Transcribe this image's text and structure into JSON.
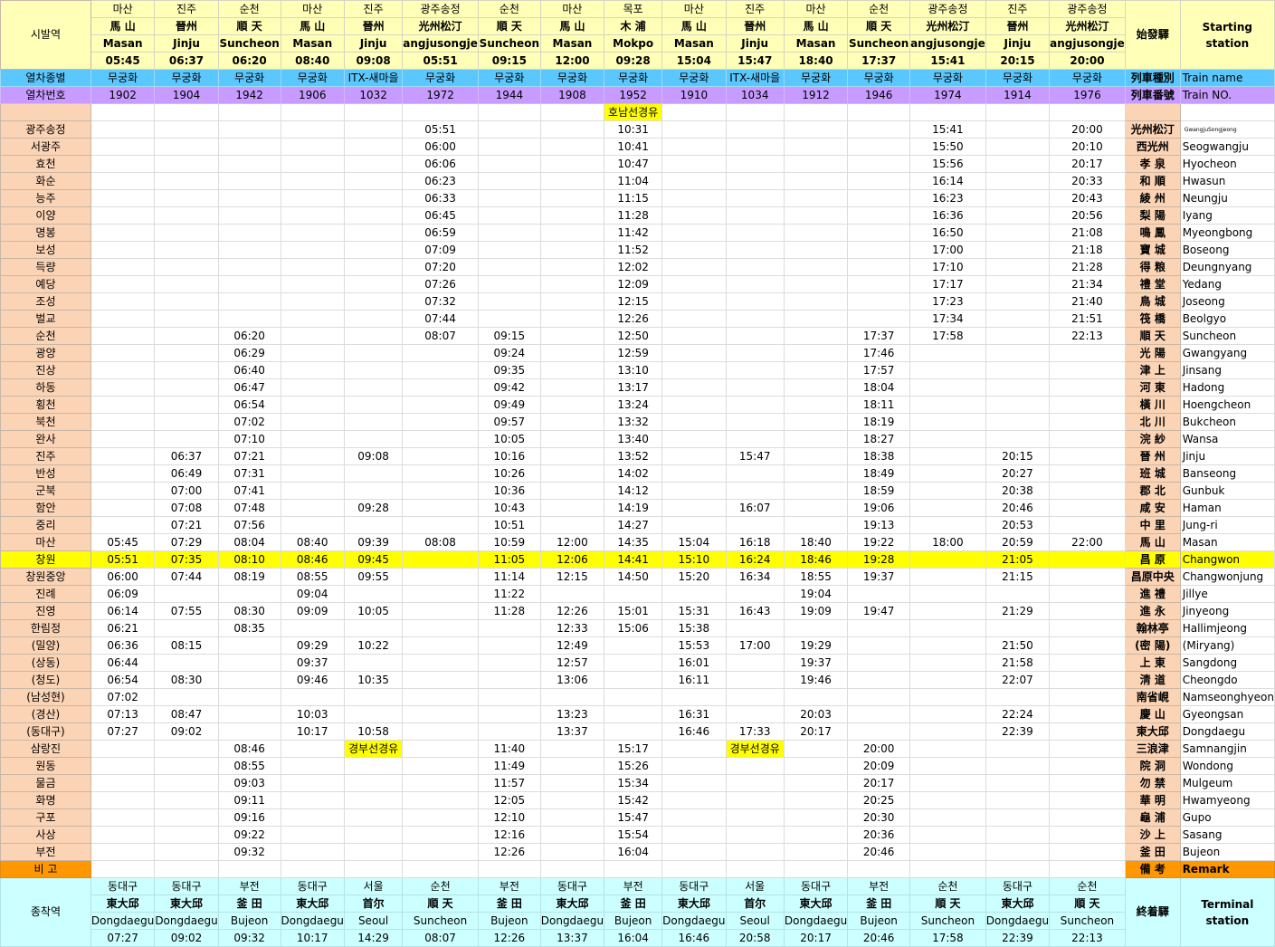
{
  "header": {
    "start_label": "시발역",
    "start_label_hanja": "始發驛",
    "start_label_en": "Starting station",
    "kind_label": "열차종별",
    "kind_label_hanja": "列車種別",
    "kind_label_en": "Train name",
    "num_label": "열차번호",
    "num_label_hanja": "列車番號",
    "num_label_en": "Train NO.",
    "remark_label": "비 고",
    "remark_label_hanja": "備 考",
    "remark_label_en": "Remark",
    "term_label": "종착역",
    "term_label_hanja": "終着驛",
    "term_label_en": "Terminal station"
  },
  "trains": [
    {
      "start_ko": "마산",
      "start_hj": "馬 山",
      "start_en": "Masan",
      "start_time": "05:45",
      "kind": "무궁화",
      "no": "1902",
      "term_ko": "동대구",
      "term_hj": "東大邱",
      "term_en": "Dongdaegu",
      "term_time": "07:27"
    },
    {
      "start_ko": "진주",
      "start_hj": "晉州",
      "start_en": "Jinju",
      "start_time": "06:37",
      "kind": "무궁화",
      "no": "1904",
      "term_ko": "동대구",
      "term_hj": "東大邱",
      "term_en": "Dongdaegu",
      "term_time": "09:02"
    },
    {
      "start_ko": "순천",
      "start_hj": "順 天",
      "start_en": "Suncheon",
      "start_time": "06:20",
      "kind": "무궁화",
      "no": "1942",
      "term_ko": "부전",
      "term_hj": "釜 田",
      "term_en": "Bujeon",
      "term_time": "09:32"
    },
    {
      "start_ko": "마산",
      "start_hj": "馬 山",
      "start_en": "Masan",
      "start_time": "08:40",
      "kind": "무궁화",
      "no": "1906",
      "term_ko": "동대구",
      "term_hj": "東大邱",
      "term_en": "Dongdaegu",
      "term_time": "10:17"
    },
    {
      "start_ko": "진주",
      "start_hj": "晉州",
      "start_en": "Jinju",
      "start_time": "09:08",
      "kind": "ITX-새마을",
      "no": "1032",
      "term_ko": "서울",
      "term_hj": "首尔",
      "term_en": "Seoul",
      "term_time": "14:29"
    },
    {
      "start_ko": "광주송정",
      "start_hj": "光州松汀",
      "start_en": "angjusongje",
      "start_time": "05:51",
      "kind": "무궁화",
      "no": "1972",
      "term_ko": "순천",
      "term_hj": "順 天",
      "term_en": "Suncheon",
      "term_time": "08:07"
    },
    {
      "start_ko": "순천",
      "start_hj": "順 天",
      "start_en": "Suncheon",
      "start_time": "09:15",
      "kind": "무궁화",
      "no": "1944",
      "term_ko": "부전",
      "term_hj": "釜 田",
      "term_en": "Bujeon",
      "term_time": "12:26"
    },
    {
      "start_ko": "마산",
      "start_hj": "馬 山",
      "start_en": "Masan",
      "start_time": "12:00",
      "kind": "무궁화",
      "no": "1908",
      "term_ko": "동대구",
      "term_hj": "東大邱",
      "term_en": "Dongdaegu",
      "term_time": "13:37"
    },
    {
      "start_ko": "목포",
      "start_hj": "木 浦",
      "start_en": "Mokpo",
      "start_time": "09:28",
      "kind": "무궁화",
      "no": "1952",
      "term_ko": "부전",
      "term_hj": "釜 田",
      "term_en": "Bujeon",
      "term_time": "16:04"
    },
    {
      "start_ko": "마산",
      "start_hj": "馬 山",
      "start_en": "Masan",
      "start_time": "15:04",
      "kind": "무궁화",
      "no": "1910",
      "term_ko": "동대구",
      "term_hj": "東大邱",
      "term_en": "Dongdaegu",
      "term_time": "16:46"
    },
    {
      "start_ko": "진주",
      "start_hj": "晉州",
      "start_en": "Jinju",
      "start_time": "15:47",
      "kind": "ITX-새마을",
      "no": "1034",
      "term_ko": "서울",
      "term_hj": "首尔",
      "term_en": "Seoul",
      "term_time": "20:58"
    },
    {
      "start_ko": "마산",
      "start_hj": "馬 山",
      "start_en": "Masan",
      "start_time": "18:40",
      "kind": "무궁화",
      "no": "1912",
      "term_ko": "동대구",
      "term_hj": "東大邱",
      "term_en": "Dongdaegu",
      "term_time": "20:17"
    },
    {
      "start_ko": "순천",
      "start_hj": "順 天",
      "start_en": "Suncheon",
      "start_time": "17:37",
      "kind": "무궁화",
      "no": "1946",
      "term_ko": "부전",
      "term_hj": "釜 田",
      "term_en": "Bujeon",
      "term_time": "20:46"
    },
    {
      "start_ko": "광주송정",
      "start_hj": "光州松汀",
      "start_en": "angjusongje",
      "start_time": "15:41",
      "kind": "무궁화",
      "no": "1974",
      "term_ko": "순천",
      "term_hj": "順 天",
      "term_en": "Suncheon",
      "term_time": "17:58"
    },
    {
      "start_ko": "진주",
      "start_hj": "晉州",
      "start_en": "Jinju",
      "start_time": "20:15",
      "kind": "무궁화",
      "no": "1914",
      "term_ko": "동대구",
      "term_hj": "東大邱",
      "term_en": "Dongdaegu",
      "term_time": "22:39"
    },
    {
      "start_ko": "광주송정",
      "start_hj": "光州松汀",
      "start_en": "angjusongje",
      "start_time": "20:00",
      "kind": "무궁화",
      "no": "1976",
      "term_ko": "순천",
      "term_hj": "順 天",
      "term_en": "Suncheon",
      "term_time": "22:13"
    }
  ],
  "notes": [
    {
      "row": 0,
      "col": 8,
      "text": "호남선경유"
    },
    {
      "row": 37,
      "col": 4,
      "text": "경부선경유"
    },
    {
      "row": 37,
      "col": 10,
      "text": "경부선경유"
    }
  ],
  "stations": [
    {
      "ko": "",
      "hj": "",
      "en": "",
      "times": [
        "",
        "",
        "",
        "",
        "",
        "",
        "",
        "",
        "",
        "",
        "",
        "",
        "",
        "",
        "",
        ""
      ]
    },
    {
      "ko": "광주송정",
      "hj": "光州松汀",
      "en": "GwangjuSongjeong",
      "times": [
        "",
        "",
        "",
        "",
        "",
        "05:51",
        "",
        "",
        "10:31",
        "",
        "",
        "",
        "",
        "15:41",
        "",
        "20:00"
      ]
    },
    {
      "ko": "서광주",
      "hj": "西光州",
      "en": "Seogwangju",
      "times": [
        "",
        "",
        "",
        "",
        "",
        "06:00",
        "",
        "",
        "10:41",
        "",
        "",
        "",
        "",
        "15:50",
        "",
        "20:10"
      ]
    },
    {
      "ko": "효천",
      "hj": "孝 泉",
      "en": "Hyocheon",
      "times": [
        "",
        "",
        "",
        "",
        "",
        "06:06",
        "",
        "",
        "10:47",
        "",
        "",
        "",
        "",
        "15:56",
        "",
        "20:17"
      ]
    },
    {
      "ko": "화순",
      "hj": "和 順",
      "en": "Hwasun",
      "times": [
        "",
        "",
        "",
        "",
        "",
        "06:23",
        "",
        "",
        "11:04",
        "",
        "",
        "",
        "",
        "16:14",
        "",
        "20:33"
      ]
    },
    {
      "ko": "능주",
      "hj": "綾 州",
      "en": "Neungju",
      "times": [
        "",
        "",
        "",
        "",
        "",
        "06:33",
        "",
        "",
        "11:15",
        "",
        "",
        "",
        "",
        "16:23",
        "",
        "20:43"
      ]
    },
    {
      "ko": "이양",
      "hj": "梨 陽",
      "en": "Iyang",
      "times": [
        "",
        "",
        "",
        "",
        "",
        "06:45",
        "",
        "",
        "11:28",
        "",
        "",
        "",
        "",
        "16:36",
        "",
        "20:56"
      ]
    },
    {
      "ko": "명봉",
      "hj": "鳴 鳳",
      "en": "Myeongbong",
      "times": [
        "",
        "",
        "",
        "",
        "",
        "06:59",
        "",
        "",
        "11:42",
        "",
        "",
        "",
        "",
        "16:50",
        "",
        "21:08"
      ]
    },
    {
      "ko": "보성",
      "hj": "寶 城",
      "en": "Boseong",
      "times": [
        "",
        "",
        "",
        "",
        "",
        "07:09",
        "",
        "",
        "11:52",
        "",
        "",
        "",
        "",
        "17:00",
        "",
        "21:18"
      ]
    },
    {
      "ko": "득량",
      "hj": "得 粮",
      "en": "Deungnyang",
      "times": [
        "",
        "",
        "",
        "",
        "",
        "07:20",
        "",
        "",
        "12:02",
        "",
        "",
        "",
        "",
        "17:10",
        "",
        "21:28"
      ]
    },
    {
      "ko": "예당",
      "hj": "禮 堂",
      "en": "Yedang",
      "times": [
        "",
        "",
        "",
        "",
        "",
        "07:26",
        "",
        "",
        "12:09",
        "",
        "",
        "",
        "",
        "17:17",
        "",
        "21:34"
      ]
    },
    {
      "ko": "조성",
      "hj": "鳥 城",
      "en": "Joseong",
      "times": [
        "",
        "",
        "",
        "",
        "",
        "07:32",
        "",
        "",
        "12:15",
        "",
        "",
        "",
        "",
        "17:23",
        "",
        "21:40"
      ]
    },
    {
      "ko": "벌교",
      "hj": "筏 橋",
      "en": "Beolgyo",
      "times": [
        "",
        "",
        "",
        "",
        "",
        "07:44",
        "",
        "",
        "12:26",
        "",
        "",
        "",
        "",
        "17:34",
        "",
        "21:51"
      ]
    },
    {
      "ko": "순천",
      "hj": "順 天",
      "en": "Suncheon",
      "times": [
        "",
        "",
        "06:20",
        "",
        "",
        "08:07",
        "09:15",
        "",
        "12:50",
        "",
        "",
        "",
        "17:37",
        "17:58",
        "",
        "22:13"
      ]
    },
    {
      "ko": "광양",
      "hj": "光 陽",
      "en": "Gwangyang",
      "times": [
        "",
        "",
        "06:29",
        "",
        "",
        "",
        "09:24",
        "",
        "12:59",
        "",
        "",
        "",
        "17:46",
        "",
        "",
        ""
      ]
    },
    {
      "ko": "진상",
      "hj": "津 上",
      "en": "Jinsang",
      "times": [
        "",
        "",
        "06:40",
        "",
        "",
        "",
        "09:35",
        "",
        "13:10",
        "",
        "",
        "",
        "17:57",
        "",
        "",
        ""
      ]
    },
    {
      "ko": "하동",
      "hj": "河 東",
      "en": "Hadong",
      "times": [
        "",
        "",
        "06:47",
        "",
        "",
        "",
        "09:42",
        "",
        "13:17",
        "",
        "",
        "",
        "18:04",
        "",
        "",
        ""
      ]
    },
    {
      "ko": "횡천",
      "hj": "橫 川",
      "en": "Hoengcheon",
      "times": [
        "",
        "",
        "06:54",
        "",
        "",
        "",
        "09:49",
        "",
        "13:24",
        "",
        "",
        "",
        "18:11",
        "",
        "",
        ""
      ]
    },
    {
      "ko": "북천",
      "hj": "北 川",
      "en": "Bukcheon",
      "times": [
        "",
        "",
        "07:02",
        "",
        "",
        "",
        "09:57",
        "",
        "13:32",
        "",
        "",
        "",
        "18:19",
        "",
        "",
        ""
      ]
    },
    {
      "ko": "완사",
      "hj": "浣 紗",
      "en": "Wansa",
      "times": [
        "",
        "",
        "07:10",
        "",
        "",
        "",
        "10:05",
        "",
        "13:40",
        "",
        "",
        "",
        "18:27",
        "",
        "",
        ""
      ]
    },
    {
      "ko": "진주",
      "hj": "晉 州",
      "en": "Jinju",
      "times": [
        "",
        "06:37",
        "07:21",
        "",
        "09:08",
        "",
        "10:16",
        "",
        "13:52",
        "",
        "15:47",
        "",
        "18:38",
        "",
        "20:15",
        ""
      ]
    },
    {
      "ko": "반성",
      "hj": "班 城",
      "en": "Banseong",
      "times": [
        "",
        "06:49",
        "07:31",
        "",
        "",
        "",
        "10:26",
        "",
        "14:02",
        "",
        "",
        "",
        "18:49",
        "",
        "20:27",
        ""
      ]
    },
    {
      "ko": "군북",
      "hj": "郡 北",
      "en": "Gunbuk",
      "times": [
        "",
        "07:00",
        "07:41",
        "",
        "",
        "",
        "10:36",
        "",
        "14:12",
        "",
        "",
        "",
        "18:59",
        "",
        "20:38",
        ""
      ]
    },
    {
      "ko": "함안",
      "hj": "咸 安",
      "en": "Haman",
      "times": [
        "",
        "07:08",
        "07:48",
        "",
        "09:28",
        "",
        "10:43",
        "",
        "14:19",
        "",
        "16:07",
        "",
        "19:06",
        "",
        "20:46",
        ""
      ]
    },
    {
      "ko": "중리",
      "hj": "中 里",
      "en": "Jung-ri",
      "times": [
        "",
        "07:21",
        "07:56",
        "",
        "",
        "",
        "10:51",
        "",
        "14:27",
        "",
        "",
        "",
        "19:13",
        "",
        "20:53",
        ""
      ]
    },
    {
      "ko": "마산",
      "hj": "馬 山",
      "en": "Masan",
      "times": [
        "05:45",
        "07:29",
        "08:04",
        "08:40",
        "09:39",
        "08:08",
        "10:59",
        "12:00",
        "14:35",
        "15:04",
        "16:18",
        "18:40",
        "19:22",
        "18:00",
        "20:59",
        "22:00"
      ]
    },
    {
      "ko": "창원",
      "hj": "昌 原",
      "en": "Changwon",
      "times": [
        "05:51",
        "07:35",
        "08:10",
        "08:46",
        "09:45",
        "",
        "11:05",
        "12:06",
        "14:41",
        "15:10",
        "16:24",
        "18:46",
        "19:28",
        "",
        "21:05",
        ""
      ]
    },
    {
      "ko": "창원중앙",
      "hj": "昌原中央",
      "en": "Changwonjung",
      "times": [
        "06:00",
        "07:44",
        "08:19",
        "08:55",
        "09:55",
        "",
        "11:14",
        "12:15",
        "14:50",
        "15:20",
        "16:34",
        "18:55",
        "19:37",
        "",
        "21:15",
        ""
      ]
    },
    {
      "ko": "진례",
      "hj": "進 禮",
      "en": "Jillye",
      "times": [
        "06:09",
        "",
        "",
        "09:04",
        "",
        "",
        "11:22",
        "",
        "",
        "",
        "",
        "19:04",
        "",
        "",
        "",
        ""
      ]
    },
    {
      "ko": "진영",
      "hj": "進 永",
      "en": "Jinyeong",
      "times": [
        "06:14",
        "07:55",
        "08:30",
        "09:09",
        "10:05",
        "",
        "11:28",
        "12:26",
        "15:01",
        "15:31",
        "16:43",
        "19:09",
        "19:47",
        "",
        "21:29",
        ""
      ]
    },
    {
      "ko": "한림정",
      "hj": "翰林亭",
      "en": "Hallimjeong",
      "times": [
        "06:21",
        "",
        "08:35",
        "",
        "",
        "",
        "",
        "12:33",
        "15:06",
        "15:38",
        "",
        "",
        "",
        "",
        "",
        ""
      ]
    },
    {
      "ko": "(밀양)",
      "hj": "(密 陽)",
      "en": "(Miryang)",
      "times": [
        "06:36",
        "08:15",
        "",
        "09:29",
        "10:22",
        "",
        "",
        "12:49",
        "",
        "15:53",
        "17:00",
        "19:29",
        "",
        "",
        "21:50",
        ""
      ]
    },
    {
      "ko": "(상동)",
      "hj": "上 東",
      "en": "Sangdong",
      "times": [
        "06:44",
        "",
        "",
        "09:37",
        "",
        "",
        "",
        "12:57",
        "",
        "16:01",
        "",
        "19:37",
        "",
        "",
        "21:58",
        ""
      ]
    },
    {
      "ko": "(청도)",
      "hj": "淸 道",
      "en": "Cheongdo",
      "times": [
        "06:54",
        "08:30",
        "",
        "09:46",
        "10:35",
        "",
        "",
        "13:06",
        "",
        "16:11",
        "",
        "19:46",
        "",
        "",
        "22:07",
        ""
      ]
    },
    {
      "ko": "(남성현)",
      "hj": "南省峴",
      "en": "Namseonghyeon",
      "times": [
        "07:02",
        "",
        "",
        "",
        "",
        "",
        "",
        "",
        "",
        "",
        "",
        "",
        "",
        "",
        "",
        ""
      ]
    },
    {
      "ko": "(경산)",
      "hj": "慶 山",
      "en": "Gyeongsan",
      "times": [
        "07:13",
        "08:47",
        "",
        "10:03",
        "",
        "",
        "",
        "13:23",
        "",
        "16:31",
        "",
        "20:03",
        "",
        "",
        "22:24",
        ""
      ]
    },
    {
      "ko": "(동대구)",
      "hj": "東大邱",
      "en": "Dongdaegu",
      "times": [
        "07:27",
        "09:02",
        "",
        "10:17",
        "10:58",
        "",
        "",
        "13:37",
        "",
        "16:46",
        "17:33",
        "20:17",
        "",
        "",
        "22:39",
        ""
      ]
    },
    {
      "ko": "삼랑진",
      "hj": "三浪津",
      "en": "Samnangjin",
      "times": [
        "",
        "",
        "08:46",
        "",
        "",
        "",
        "11:40",
        "",
        "15:17",
        "",
        "",
        "",
        "20:00",
        "",
        "",
        ""
      ]
    },
    {
      "ko": "원동",
      "hj": "院 洞",
      "en": "Wondong",
      "times": [
        "",
        "",
        "08:55",
        "",
        "",
        "",
        "11:49",
        "",
        "15:26",
        "",
        "",
        "",
        "20:09",
        "",
        "",
        ""
      ]
    },
    {
      "ko": "물금",
      "hj": "勿 禁",
      "en": "Mulgeum",
      "times": [
        "",
        "",
        "09:03",
        "",
        "",
        "",
        "11:57",
        "",
        "15:34",
        "",
        "",
        "",
        "20:17",
        "",
        "",
        ""
      ]
    },
    {
      "ko": "화명",
      "hj": "華 明",
      "en": "Hwamyeong",
      "times": [
        "",
        "",
        "09:11",
        "",
        "",
        "",
        "12:05",
        "",
        "15:42",
        "",
        "",
        "",
        "20:25",
        "",
        "",
        ""
      ]
    },
    {
      "ko": "구포",
      "hj": "龜 浦",
      "en": "Gupo",
      "times": [
        "",
        "",
        "09:16",
        "",
        "",
        "",
        "12:10",
        "",
        "15:47",
        "",
        "",
        "",
        "20:30",
        "",
        "",
        ""
      ]
    },
    {
      "ko": "사상",
      "hj": "沙 上",
      "en": "Sasang",
      "times": [
        "",
        "",
        "09:22",
        "",
        "",
        "",
        "12:16",
        "",
        "15:54",
        "",
        "",
        "",
        "20:36",
        "",
        "",
        ""
      ]
    },
    {
      "ko": "부전",
      "hj": "釜 田",
      "en": "Bujeon",
      "times": [
        "",
        "",
        "09:32",
        "",
        "",
        "",
        "12:26",
        "",
        "16:04",
        "",
        "",
        "",
        "20:46",
        "",
        "",
        ""
      ]
    }
  ],
  "highlight_row": 26,
  "colors": {
    "station_bg": "#fbd3b5",
    "header_bg": "#ffffb8",
    "kind_bg": "#5ac8ff",
    "num_bg": "#c79bff",
    "highlight": "#ffff00",
    "remark_bg": "#ff9800",
    "terminal_bg": "#ccffff"
  }
}
